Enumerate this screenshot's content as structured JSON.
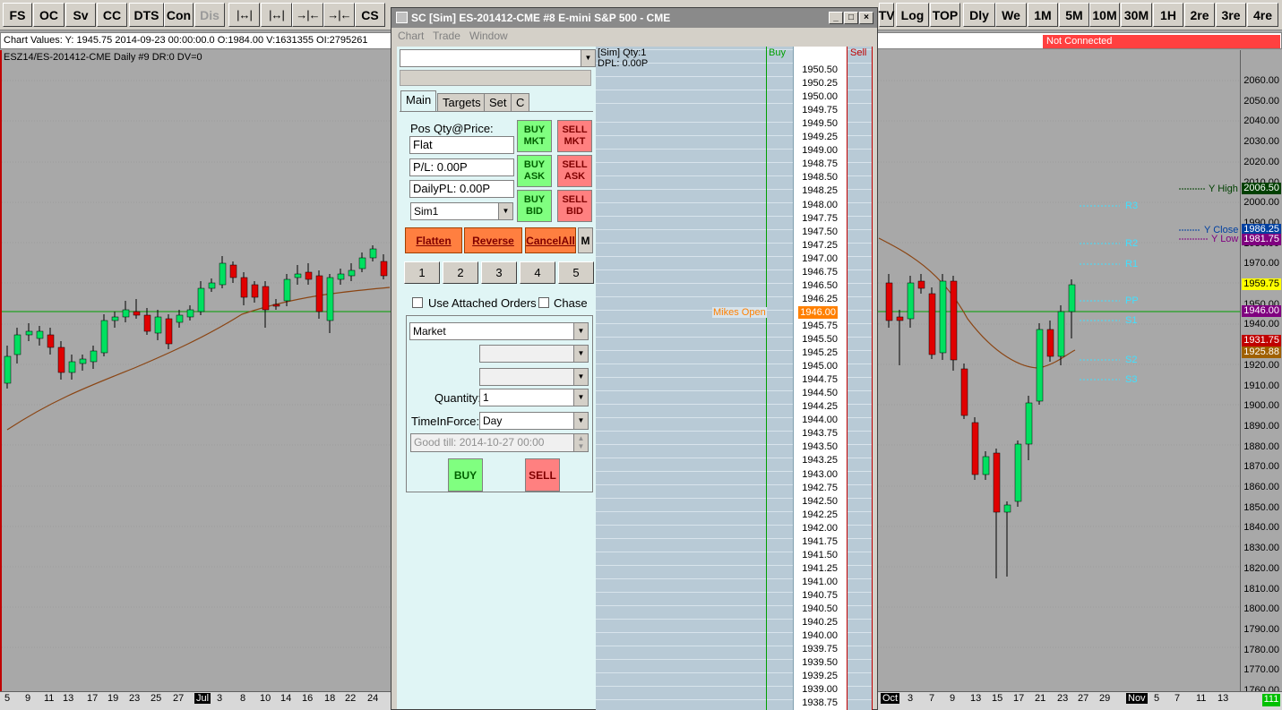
{
  "toolbar": {
    "left_buttons": [
      "FS",
      "OC",
      "Sv",
      "CC",
      "DTS",
      "Con",
      "Dis"
    ],
    "icon_buttons": [
      "|↔|",
      "|↔|",
      "→|←",
      "→|←"
    ],
    "cs_label": "CS",
    "right_buttons": [
      "TV",
      "Log",
      "TOP",
      "Dly",
      "We",
      "1M",
      "5M",
      "10M",
      "30M",
      "1H",
      "2re",
      "3re",
      "4re"
    ]
  },
  "info": {
    "chart_values": "Chart Values: Y: 1945.75  2014-09-23  00:00:00.0  O:1984.00  V:1631355  OI:2795261",
    "connection_status": "Not Connected",
    "chart_title": "ESZ14/ES-201412-CME  Daily  #9 DR:0 DV=0"
  },
  "price_axis": {
    "ticks": [
      "2060.00",
      "2050.00",
      "2040.00",
      "2030.00",
      "2020.00",
      "2010.00",
      "2000.00",
      "1990.00",
      "1980.00",
      "1970.00",
      "1960.00",
      "1950.00",
      "1940.00",
      "1930.00",
      "1920.00",
      "1910.00",
      "1900.00",
      "1890.00",
      "1880.00",
      "1870.00",
      "1860.00",
      "1850.00",
      "1840.00",
      "1830.00",
      "1820.00",
      "1810.00",
      "1800.00",
      "1790.00",
      "1780.00",
      "1770.00",
      "1760.00"
    ],
    "labels": [
      {
        "text": "2006.50",
        "bg": "#004000",
        "fg": "#ffffff"
      },
      {
        "text": "1986.25",
        "bg": "#0040a0",
        "fg": "#ffffff"
      },
      {
        "text": "1981.75",
        "bg": "#800080",
        "fg": "#ffffff"
      },
      {
        "text": "1959.75",
        "bg": "#ffff00",
        "fg": "#000000"
      },
      {
        "text": "1946.00",
        "bg": "#800080",
        "fg": "#ffffff"
      },
      {
        "text": "1931.75",
        "bg": "#c00000",
        "fg": "#ffffff"
      },
      {
        "text": "1925.88",
        "bg": "#a06000",
        "fg": "#ffffff"
      }
    ]
  },
  "chart_annotations": {
    "y_high": "Y High",
    "y_close": "Y Close",
    "y_low": "Y Low",
    "pivots": [
      "R3",
      "R2",
      "R1",
      "PP",
      "S1",
      "S2",
      "S3"
    ]
  },
  "time_axis": {
    "left_ticks": [
      "5",
      "9",
      "11",
      "13",
      "17",
      "19",
      "23",
      "25",
      "27",
      "Jul",
      "3",
      "8",
      "10",
      "14",
      "16",
      "18",
      "22",
      "24"
    ],
    "right_ticks": [
      "Oct",
      "3",
      "7",
      "9",
      "13",
      "15",
      "17",
      "21",
      "23",
      "27",
      "29",
      "Nov",
      "5",
      "7",
      "11",
      "13"
    ],
    "corner": "111"
  },
  "trade_window": {
    "title": "SC [Sim] ES-201412-CME  #8  E-mini S&P 500 - CME",
    "menu": [
      "Chart",
      "Trade",
      "Window"
    ],
    "tabs": [
      "Main",
      "Targets",
      "Set",
      "C"
    ],
    "pos_label": "Pos Qty@Price:",
    "pos_value": "Flat",
    "pl_value": "P/L: 0.00P",
    "daily_pl_value": "DailyPL: 0.00P",
    "account": "Sim1",
    "buy_mkt": "BUY MKT",
    "sell_mkt": "SELL MKT",
    "buy_ask": "BUY ASK",
    "sell_ask": "SELL ASK",
    "buy_bid": "BUY BID",
    "sell_bid": "SELL BID",
    "flatten": "Flatten",
    "reverse": "Reverse",
    "cancel_all": "CancelAll",
    "m": "M",
    "qty_buttons": [
      "1",
      "2",
      "3",
      "4",
      "5"
    ],
    "use_attached_orders": "Use Attached Orders",
    "chase": "Chase",
    "order_type": "Market",
    "quantity_label": "Quantity:",
    "quantity_value": "1",
    "tif_label": "TimeInForce:",
    "tif_value": "Day",
    "good_till": "Good till: 2014-10-27 00:00",
    "buy": "BUY",
    "sell": "SELL"
  },
  "ladder": {
    "sim_info": "[Sim]  Qty:1",
    "dpl": "DPL: 0.00P",
    "buy_header": "Buy",
    "sell_header": "Sell",
    "mikes_open": "Mikes Open",
    "last_price": "1946.00",
    "prices": [
      "1950.50",
      "1950.25",
      "1950.00",
      "1949.75",
      "1949.50",
      "1949.25",
      "1949.00",
      "1948.75",
      "1948.50",
      "1948.25",
      "1948.00",
      "1947.75",
      "1947.50",
      "1947.25",
      "1947.00",
      "1946.75",
      "1946.50",
      "1946.25",
      "1946.00",
      "1945.75",
      "1945.50",
      "1945.25",
      "1945.00",
      "1944.75",
      "1944.50",
      "1944.25",
      "1944.00",
      "1943.75",
      "1943.50",
      "1943.25",
      "1943.00",
      "1942.75",
      "1942.50",
      "1942.25",
      "1942.00",
      "1941.75",
      "1941.50",
      "1941.25",
      "1941.00",
      "1940.75",
      "1940.50",
      "1940.25",
      "1940.00",
      "1939.75",
      "1939.50",
      "1939.25",
      "1939.00",
      "1938.75"
    ]
  },
  "colors": {
    "up": "#00e060",
    "down": "#e00000",
    "ma": "#8b4513",
    "pivot": "#40e0ff",
    "h_line": "#00a000"
  }
}
